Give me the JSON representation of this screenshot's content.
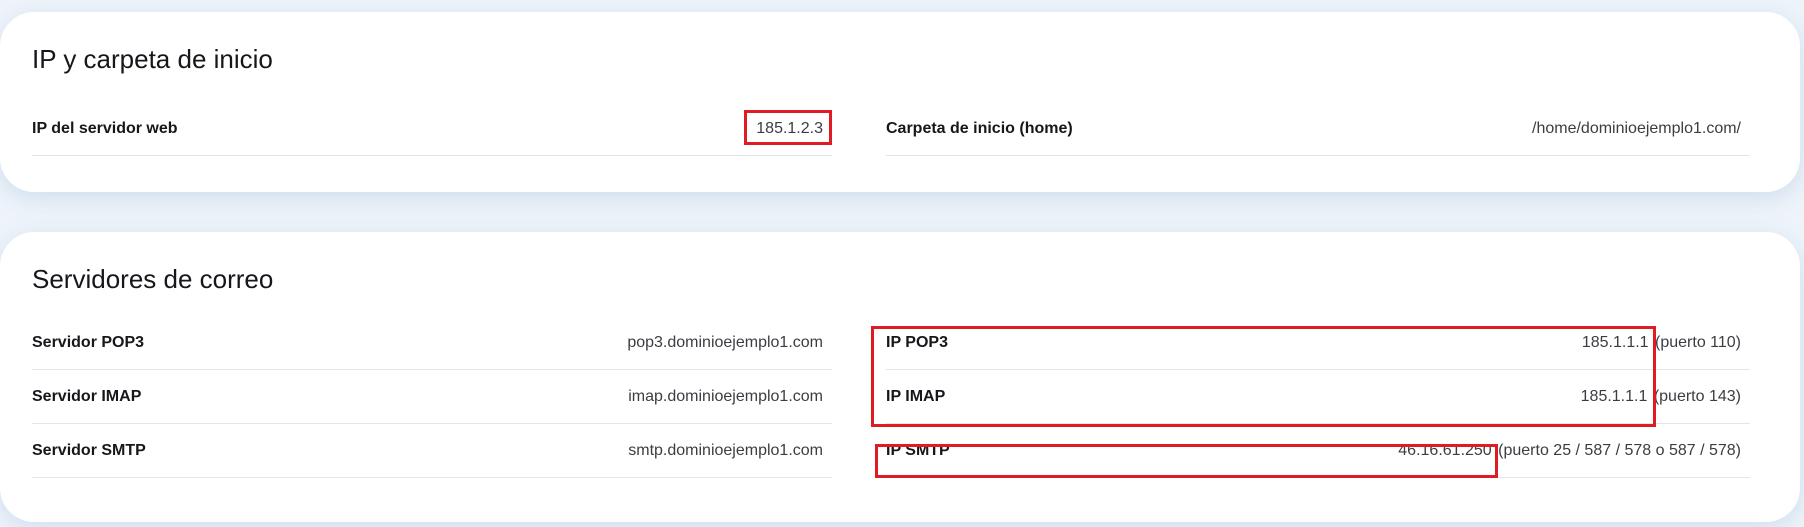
{
  "ip_section": {
    "title": "IP y carpeta de inicio",
    "web_ip": {
      "label": "IP del servidor web",
      "value": "185.1.2.3"
    },
    "home": {
      "label": "Carpeta de inicio (home)",
      "value": "/home/dominioejemplo1.com/"
    }
  },
  "mail_section": {
    "title": "Servidores de correo",
    "pop3_server": {
      "label": "Servidor POP3",
      "value": "pop3.dominioejemplo1.com"
    },
    "imap_server": {
      "label": "Servidor IMAP",
      "value": "imap.dominioejemplo1.com"
    },
    "smtp_server": {
      "label": "Servidor SMTP",
      "value": "smtp.dominioejemplo1.com"
    },
    "pop3_ip": {
      "label": "IP POP3",
      "value": "185.1.1.1",
      "port": "(puerto 110)"
    },
    "imap_ip": {
      "label": "IP IMAP",
      "value": "185.1.1.1",
      "port": "(puerto 143)"
    },
    "smtp_ip": {
      "label": "IP SMTP",
      "value": "46.16.61.250",
      "port": "(puerto 25 / 587 / 578 o 587 / 578)"
    }
  },
  "colors": {
    "highlight": "#e01b24",
    "card": "#ffffff",
    "background": "#eef4fa"
  }
}
